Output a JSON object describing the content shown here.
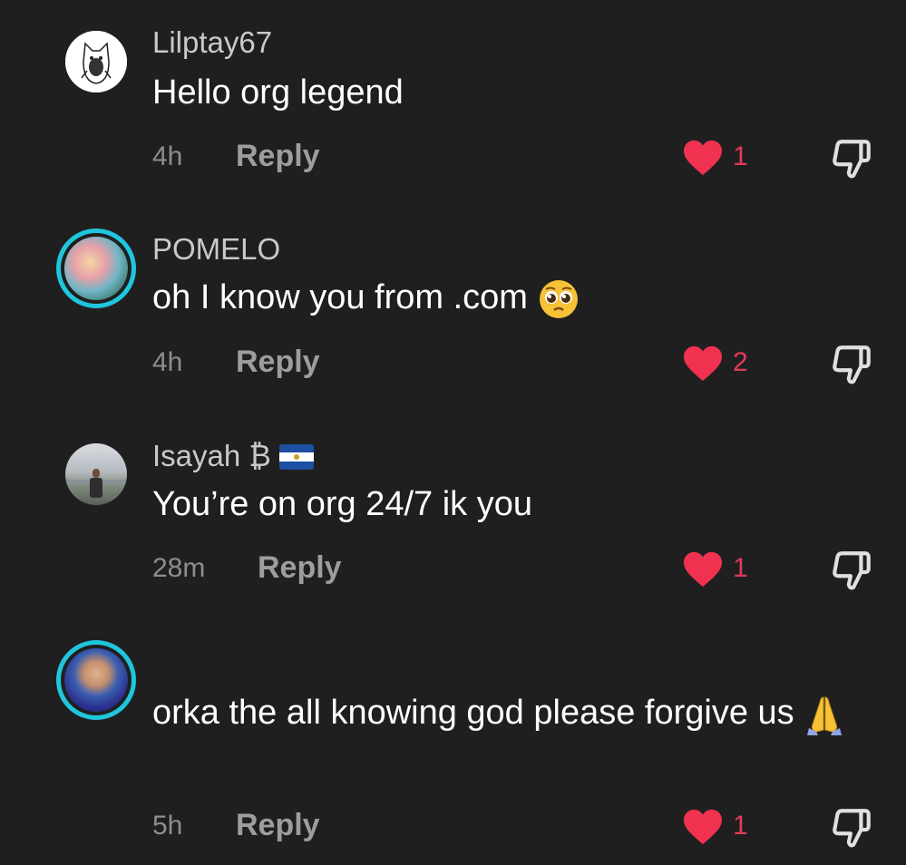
{
  "comments": [
    {
      "username": "Lilptay67",
      "text": "Hello org legend",
      "time": "4h",
      "reply_label": "Reply",
      "likes": "1"
    },
    {
      "username": "POMELO",
      "text": "oh I know you from .com",
      "emoji": "pleading-face-emoji",
      "time": "4h",
      "reply_label": "Reply",
      "likes": "2"
    },
    {
      "username": "Isayah ₿",
      "flag": "el-salvador-flag-icon",
      "text": "You’re on org 24/7 ik you",
      "time": "28m",
      "reply_label": "Reply",
      "likes": "1"
    },
    {
      "username": "",
      "text": "orka the all knowing god please forgive us",
      "emoji": "folded-hands-emoji",
      "time": "5h",
      "reply_label": "Reply",
      "likes": "1"
    }
  ],
  "colors": {
    "background": "#1f1f1f",
    "heart": "#f03250",
    "like_count": "#e23a5a",
    "avatar_ring": "#20c5de",
    "username": "#c9c9c9",
    "meta": "#8e8e8e"
  }
}
